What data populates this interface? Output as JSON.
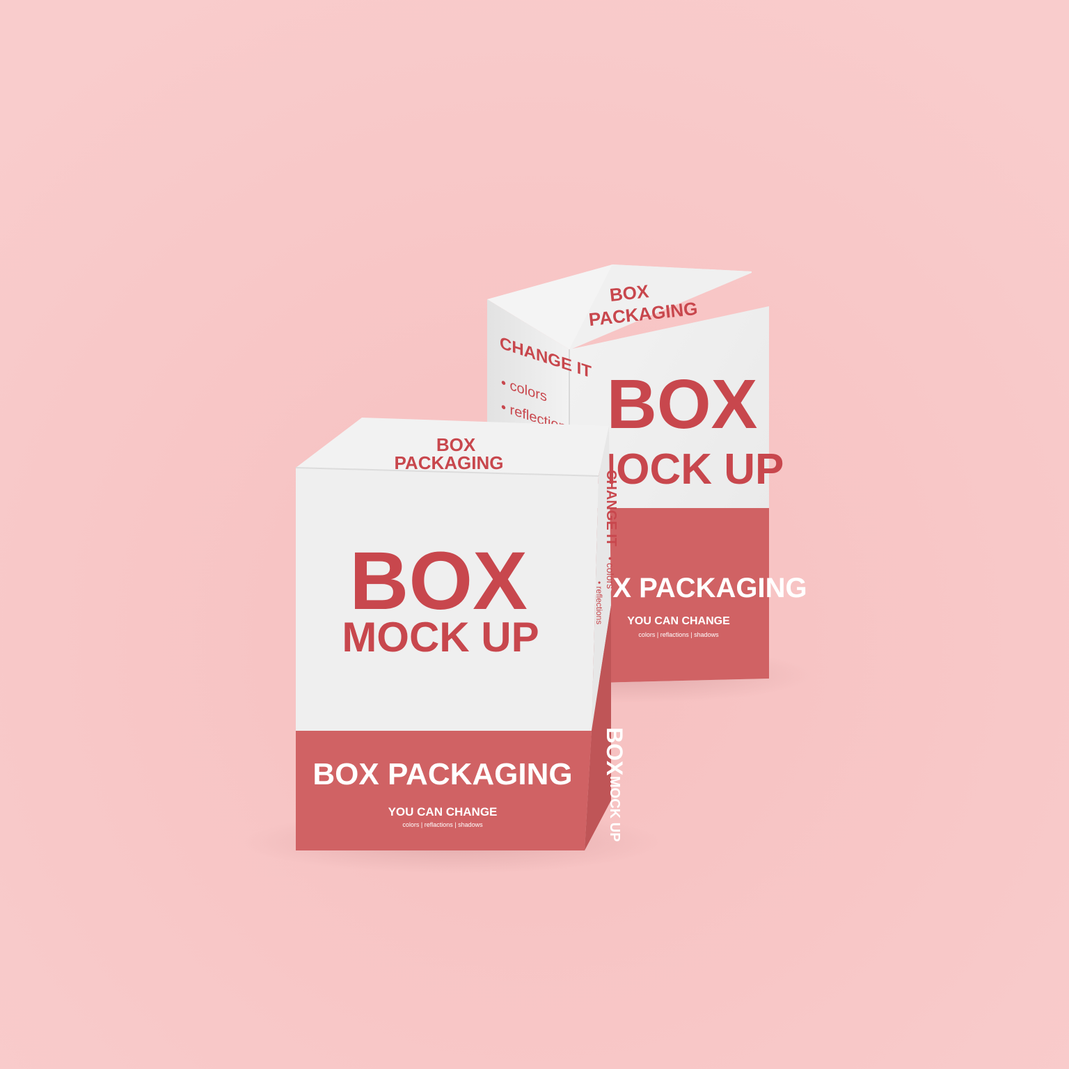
{
  "colors": {
    "background": "#f8c9c9",
    "box_white": "#eeeeee",
    "box_red": "#d06264",
    "text_red": "#c8474d",
    "text_white": "#ffffff"
  },
  "back_box": {
    "lid_top": "BOX",
    "lid_bottom": "PACKAGING",
    "front_title": "BOX",
    "front_subtitle": "MOCK UP",
    "band_title": "BOX PACKAGING",
    "band_tagline": "YOU CAN CHANGE",
    "band_small": "colors  |  reflactions  |  shadows",
    "side_heading": "CHANGE IT",
    "side_item_1": "• colors",
    "side_item_2": "• reflections"
  },
  "front_box": {
    "lid_top": "BOX",
    "lid_bottom": "PACKAGING",
    "front_title": "BOX",
    "front_subtitle": "MOCK UP",
    "band_title": "BOX PACKAGING",
    "band_tagline": "YOU CAN CHANGE",
    "band_small": "colors  |  reflactions  |  shadows",
    "side_heading": "CHANGE IT",
    "side_item_1": "• colors",
    "side_item_2": "• reflections",
    "side_band_title": "BOX",
    "side_band_subtitle": "MOCK UP"
  }
}
